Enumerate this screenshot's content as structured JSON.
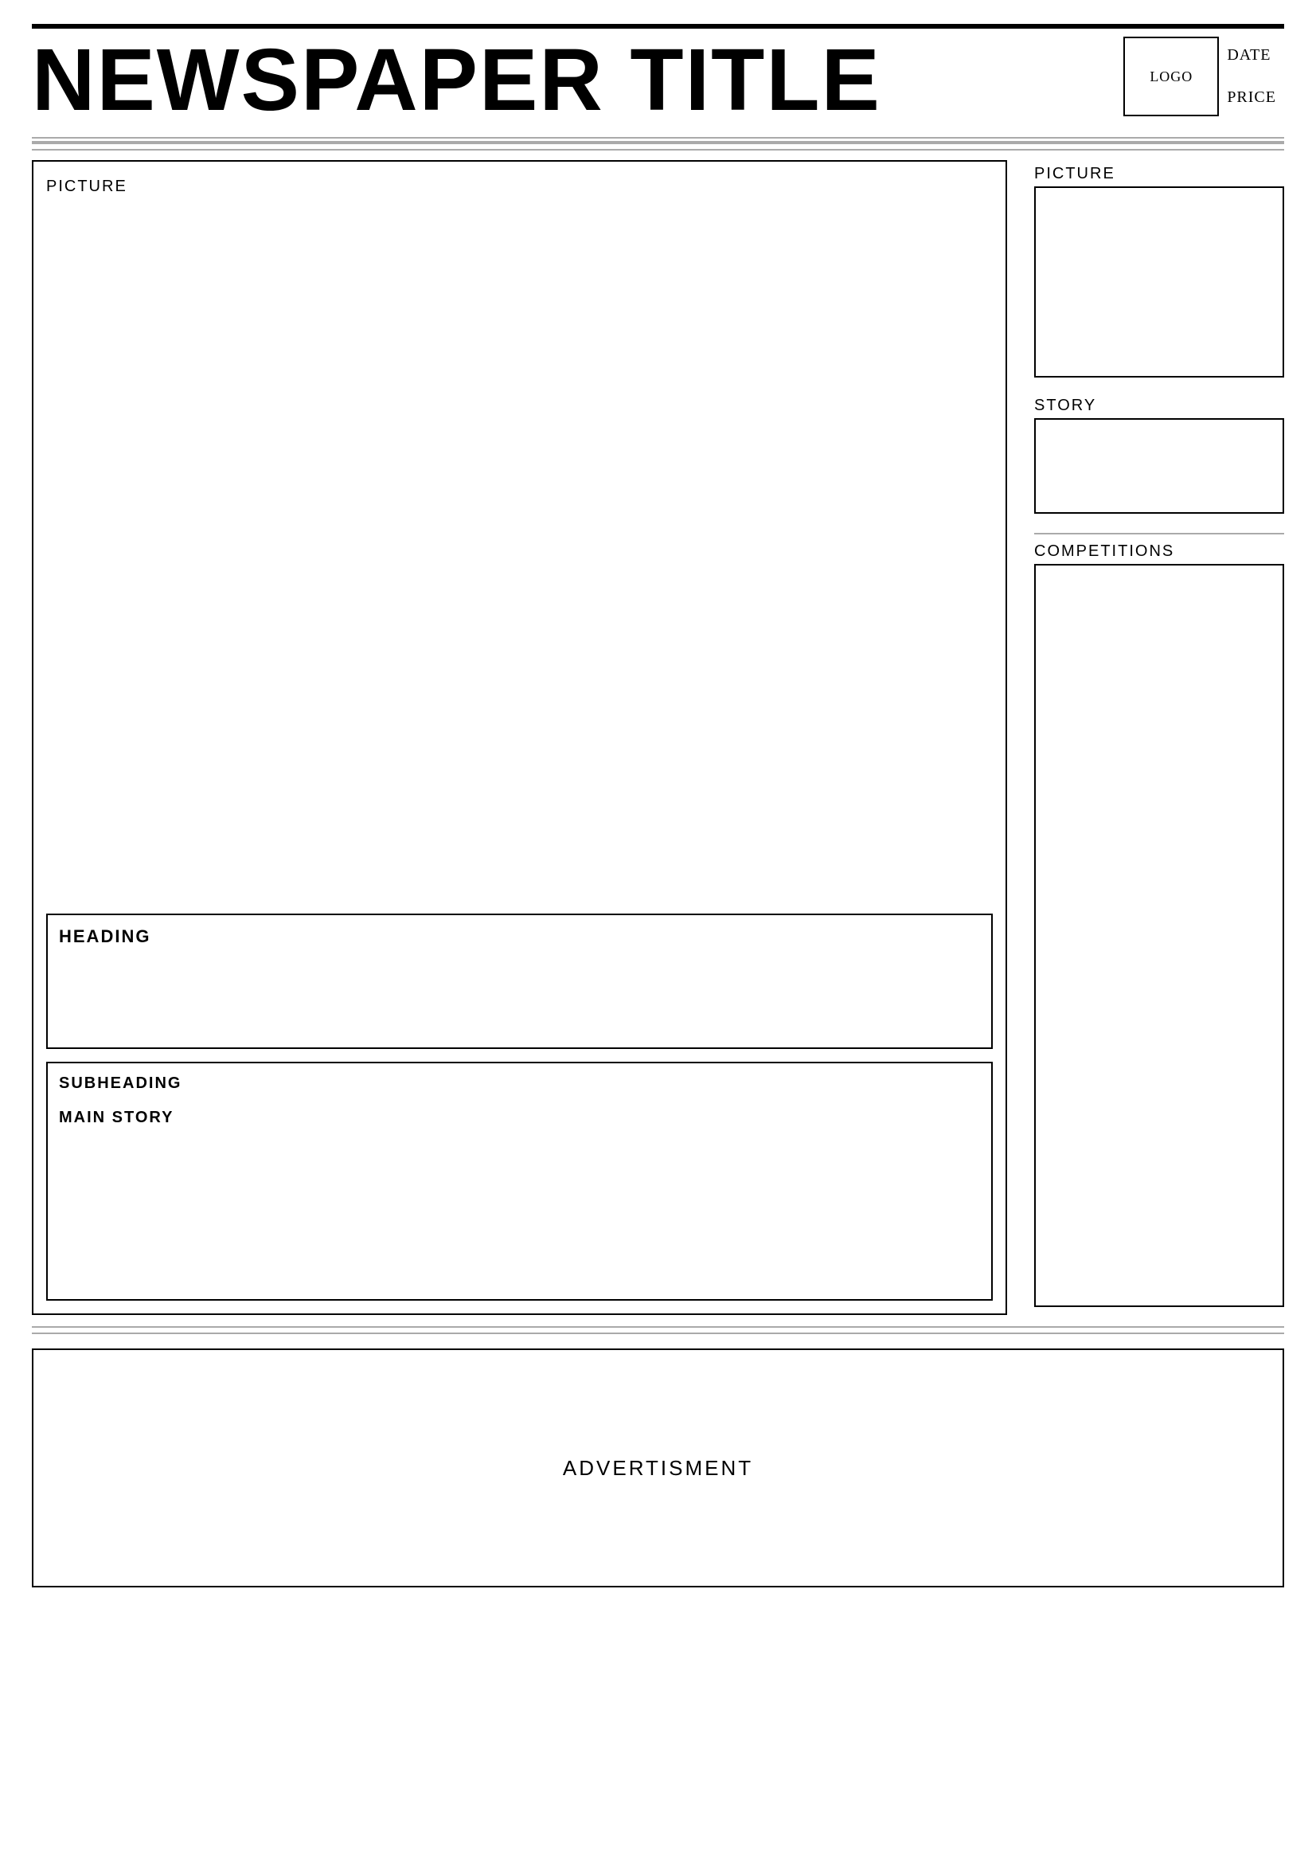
{
  "header": {
    "title": "NEWSPAPER TITLE",
    "logo_label": "LOGO",
    "date_label": "DATE",
    "price_label": "PRICE"
  },
  "main": {
    "left": {
      "picture_label": "PICTURE",
      "heading_label": "HEADING",
      "subheading_label": "SUBHEADING",
      "main_story_label": "MAIN STORY"
    },
    "right": {
      "picture_label": "PICTURE",
      "story_label": "STORY",
      "competitions_label": "COMPETITIONS"
    }
  },
  "advertisement": {
    "label": "ADVERTISMENT"
  }
}
